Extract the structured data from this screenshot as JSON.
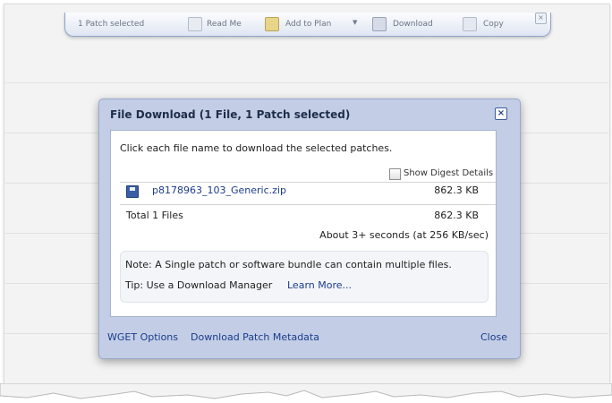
{
  "toolbar": {
    "selection": "1 Patch selected",
    "read_me": "Read Me",
    "add_to_plan": "Add to Plan",
    "download": "Download",
    "copy": "Copy",
    "close_glyph": "×",
    "caret_glyph": "▼"
  },
  "dialog": {
    "title": "File Download (1 File, 1 Patch selected)",
    "close_glyph": "×",
    "instructions": "Click each file name to download the selected patches.",
    "show_digest_label": "Show Digest Details",
    "show_digest_checked": false,
    "files": [
      {
        "name": "p8178963_103_Generic.zip",
        "size": "862.3 KB",
        "icon": "save-disk-icon"
      }
    ],
    "total_label": "Total 1 Files",
    "total_size": "862.3 KB",
    "estimate": "About 3+ seconds (at 256 KB/sec)",
    "note": "Note: A Single patch or software bundle can contain multiple files.",
    "tip": "Tip: Use a Download Manager",
    "learn_more": "Learn More...",
    "footer": {
      "wget": "WGET Options",
      "metadata": "Download Patch Metadata",
      "close": "Close"
    }
  },
  "colors": {
    "dialog_frame": "#c3cee6",
    "link": "#1b3c8c",
    "title_text": "#1f2d4a"
  }
}
